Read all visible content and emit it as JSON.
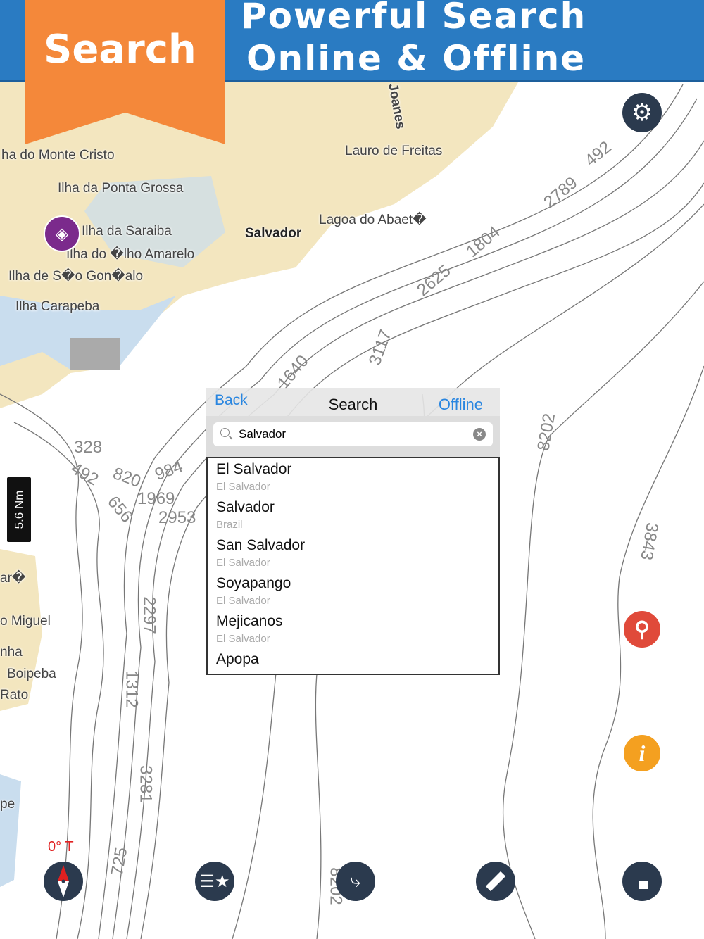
{
  "banner": {
    "ribbon": "Search",
    "line1": "Powerful Search",
    "line2": "Online & Offline"
  },
  "map": {
    "places": [
      "ha do Monte Cristo",
      "Ilha da Ponta Grossa",
      "Ilha da Saraiba",
      "Ilha do �lho Amarelo",
      "Ilha de S�o Gon�alo",
      "Ilha Carapeba",
      "Salvador",
      "Lauro de Freitas",
      "Lagoa do Abaet�",
      "Joanes",
      "ar�",
      "o Miguel",
      "nha",
      "Boipeba",
      "Rato",
      "pe"
    ],
    "depths": [
      "2789",
      "492",
      "1804",
      "2625",
      "3117",
      "1640",
      "8202",
      "3843",
      "328",
      "492",
      "820",
      "984",
      "656",
      "1969",
      "2953",
      "2297",
      "1312",
      "3281",
      "725",
      "8202"
    ],
    "scale": "5.6 Nm",
    "heading": "0° T"
  },
  "search": {
    "back": "Back",
    "title": "Search",
    "offline": "Offline",
    "query": "Salvador",
    "results": [
      {
        "name": "El Salvador",
        "sub": "El Salvador"
      },
      {
        "name": "Salvador",
        "sub": "Brazil"
      },
      {
        "name": "San Salvador",
        "sub": "El Salvador"
      },
      {
        "name": "Soyapango",
        "sub": "El Salvador"
      },
      {
        "name": "Mejicanos",
        "sub": "El Salvador"
      },
      {
        "name": "Apopa",
        "sub": ""
      }
    ]
  },
  "colors": {
    "banner": "#2a7bc2",
    "ribbon": "#f4883a",
    "button": "#2b3a4e",
    "search_btn": "#e04a3a",
    "info_btn": "#f4a020",
    "link": "#2a86e0"
  }
}
